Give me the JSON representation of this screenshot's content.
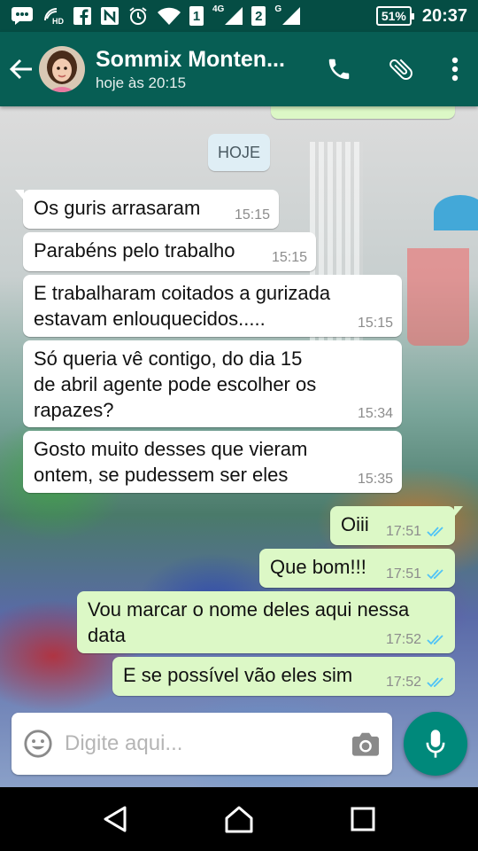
{
  "status_bar": {
    "sim1": "1",
    "sim1_network": "4G",
    "sim2": "2",
    "sim2_network": "G",
    "battery": "51%",
    "time": "20:37"
  },
  "header": {
    "contact_name": "Sommix Monten...",
    "last_seen": "hoje às 20:15"
  },
  "chat": {
    "date_chip": "HOJE",
    "messages": [
      {
        "text": "Os guris arrasaram",
        "time": "15:15"
      },
      {
        "text": "Parabéns pelo trabalho",
        "time": "15:15"
      },
      {
        "text": "E trabalharam coitados a gurizada\nestavam enlouquecidos.....",
        "time": "15:15"
      },
      {
        "text": "Só queria vê contigo, do dia 15\nde abril agente pode escolher os\nrapazes?",
        "time": "15:34"
      },
      {
        "text": "Gosto muito desses que vieram\nontem, se pudessem ser eles",
        "time": "15:35"
      },
      {
        "text": "Oiii",
        "time": "17:51",
        "status": "read"
      },
      {
        "text": "Que bom!!!",
        "time": "17:51",
        "status": "read"
      },
      {
        "text": "Vou marcar o nome deles aqui nessa\ndata",
        "time": "17:52",
        "status": "read"
      },
      {
        "text": "E se possível vão eles sim",
        "time": "17:52",
        "status": "read"
      }
    ]
  },
  "composer": {
    "placeholder": "Digite aqui..."
  },
  "colors": {
    "header": "#075e54",
    "status_bar": "#054d44",
    "outgoing_bubble": "#dcf8c6",
    "incoming_bubble": "#ffffff",
    "read_ticks": "#4fc3f7",
    "mic_button": "#00897b"
  },
  "icons": [
    "back-arrow-icon",
    "phone-icon",
    "attach-icon",
    "more-vert-icon",
    "emoji-icon",
    "camera-icon",
    "mic-icon",
    "nav-back-icon",
    "nav-home-icon",
    "nav-recents-icon"
  ]
}
